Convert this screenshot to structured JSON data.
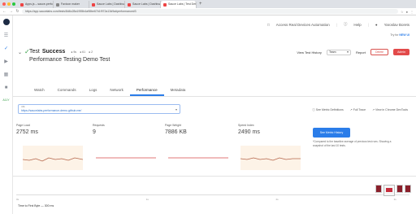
{
  "browser": {
    "tabs": [
      {
        "label": "Apps.js – sauce-performance..."
      },
      {
        "label": "Favicon maker"
      },
      {
        "label": "Sauce Labs | Dashboards"
      },
      {
        "label": "Sauce Labs | Dashboards"
      },
      {
        "label": "Sauce Labs | Test Details"
      }
    ],
    "url": "https://app.saucelabs.com/tests/8d6c28a1955b4a98be67b1f972a13d9a#performance#3"
  },
  "topbar": {
    "access_real_devices": "Access Real Devices Automation",
    "help": "Help",
    "user": "Yaroslav Borets"
  },
  "trial": {
    "prefix": "Try for",
    "link": "NEW UI"
  },
  "test": {
    "title_prefix": "Test",
    "status": "Success",
    "meta": [
      "● 9s",
      "● 61",
      "● 2"
    ],
    "name": "Performance Testing Demo Test"
  },
  "actions": {
    "history": "View Test History",
    "team": "Team",
    "report": "Report",
    "delete": "Delete",
    "admin": "Admin"
  },
  "tabs": [
    "Watch",
    "Commands",
    "Logs",
    "Network",
    "Performance",
    "Metadata"
  ],
  "url_field": {
    "label": "URL",
    "value": "https://saucelabs-performance-demo.github.me/"
  },
  "links": [
    "See Metric Definitions",
    "Full Trace",
    "View in Chrome DevTools"
  ],
  "metrics": [
    {
      "label": "Page Load",
      "value": "2752 ms"
    },
    {
      "label": "Requests",
      "value": "9"
    },
    {
      "label": "Page Weight",
      "value": "7886 KB"
    },
    {
      "label": "Speed Index",
      "value": "2490 ms"
    }
  ],
  "see_history": "See Metric History",
  "compared_note": "*Compared to the baseline average of previous test runs. Showing a snapshot of the last 10 tests.",
  "filmstrip": {
    "ticks": [
      "0s",
      "1s",
      "2s",
      "3s"
    ],
    "ttfb": "Time to First Byte — 300 ms"
  },
  "colors": {
    "accent": "#2b7de9",
    "success": "#3aa14b",
    "danger": "#e24a4a",
    "spark_fill": "#fdf3e7",
    "spark_line": "#b5654a"
  }
}
